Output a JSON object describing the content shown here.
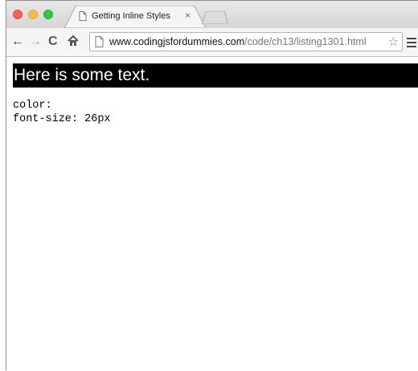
{
  "tab": {
    "title": "Getting Inline Styles",
    "close_glyph": "×"
  },
  "address": {
    "host": "www.codingjsfordummies.com",
    "path": "/code/ch13/listing1301.html"
  },
  "toolbar": {
    "back_glyph": "←",
    "forward_glyph": "→",
    "reload_glyph": "C",
    "home_glyph": "🏠",
    "star_glyph": "☆"
  },
  "content": {
    "heading": "Here is some text.",
    "lines": [
      "color:",
      "font-size: 26px"
    ]
  },
  "colors": {
    "heading_bg": "#000000",
    "heading_fg": "#ffffff",
    "traffic_red": "#fc605c",
    "traffic_yellow": "#fdbc40",
    "traffic_green": "#34c84a"
  },
  "icons": [
    "page-icon",
    "star-icon",
    "menu-icon",
    "close-icon",
    "back-arrow-icon",
    "forward-arrow-icon",
    "reload-icon",
    "home-icon"
  ]
}
